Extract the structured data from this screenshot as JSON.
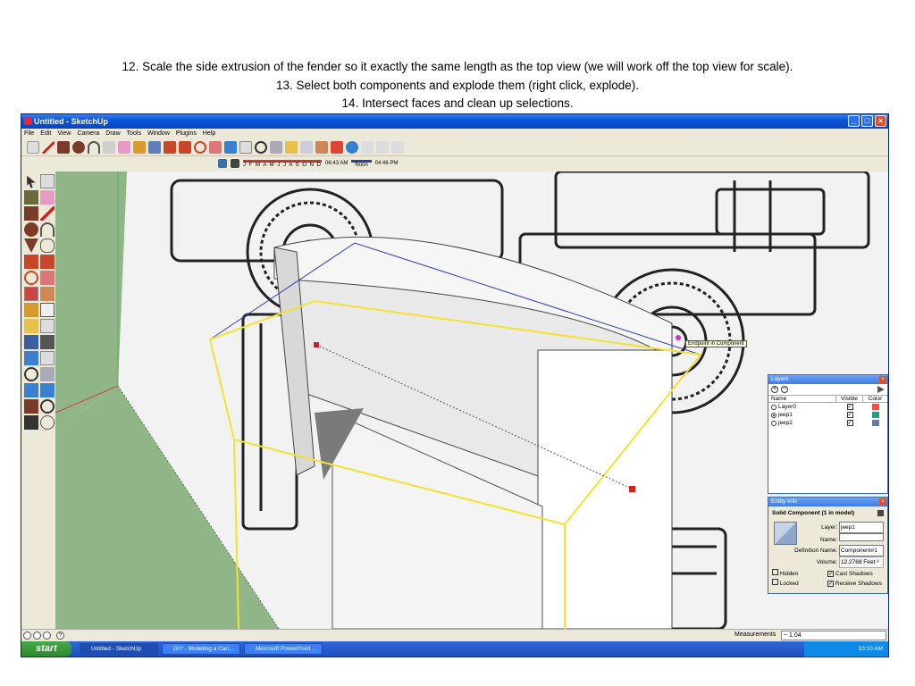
{
  "captions": [
    "12. Scale the side extrusion of the fender so it exactly the same length as the top view (we will work off the top view for scale).",
    "13. Select both components and explode them (right click, explode).",
    "14. Intersect faces and clean up selections."
  ],
  "window": {
    "title": "Untitled - SketchUp",
    "buttons": [
      "_",
      "□",
      "×"
    ]
  },
  "menu": [
    "File",
    "Edit",
    "View",
    "Camera",
    "Draw",
    "Tools",
    "Window",
    "Plugins",
    "Help"
  ],
  "shadow_toolbar": {
    "months": "J F M A M J J A S O N D",
    "time_start": "06:43 AM",
    "noon": "Noon",
    "time_end": "04:46 PM"
  },
  "viewport": {
    "tooltip": "Endpoint in Component"
  },
  "layers_panel": {
    "title": "Layers",
    "headers": [
      "Name",
      "Visible",
      "Color"
    ],
    "rows": [
      {
        "name": "Layer0",
        "selected": false,
        "visible": true,
        "color": "#e8524a"
      },
      {
        "name": "jeep1",
        "selected": true,
        "visible": true,
        "color": "#1aa37a"
      },
      {
        "name": "jeep2",
        "selected": false,
        "visible": true,
        "color": "#6a7a9a"
      }
    ]
  },
  "entity_panel": {
    "title": "Entity Info",
    "heading": "Solid Component (1 in model)",
    "layer_label": "Layer:",
    "layer_value": "jeep1",
    "name_label": "Name:",
    "name_value": "",
    "def_label": "Definition Name:",
    "def_value": "Component#1",
    "volume_label": "Volume:",
    "volume_value": "12.2768 Feet ³",
    "hidden_label": "Hidden",
    "locked_label": "Locked",
    "cast_label": "Cast Shadows",
    "receive_label": "Receive Shadows"
  },
  "status": {
    "measurements_label": "Measurements",
    "measurements_value": "~ 1.04"
  },
  "taskbar": {
    "start": "start",
    "tasks": [
      "Untitled - SketchUp",
      "DIY - Modeling a Car/...",
      "Microsoft PowerPoint ..."
    ],
    "clock": "10:10 AM"
  },
  "colors": {
    "ground": "#8fb588",
    "selection": "#f4e233",
    "edge_blue": "#2b3fb0",
    "xp_blue": "#0a53d8"
  }
}
